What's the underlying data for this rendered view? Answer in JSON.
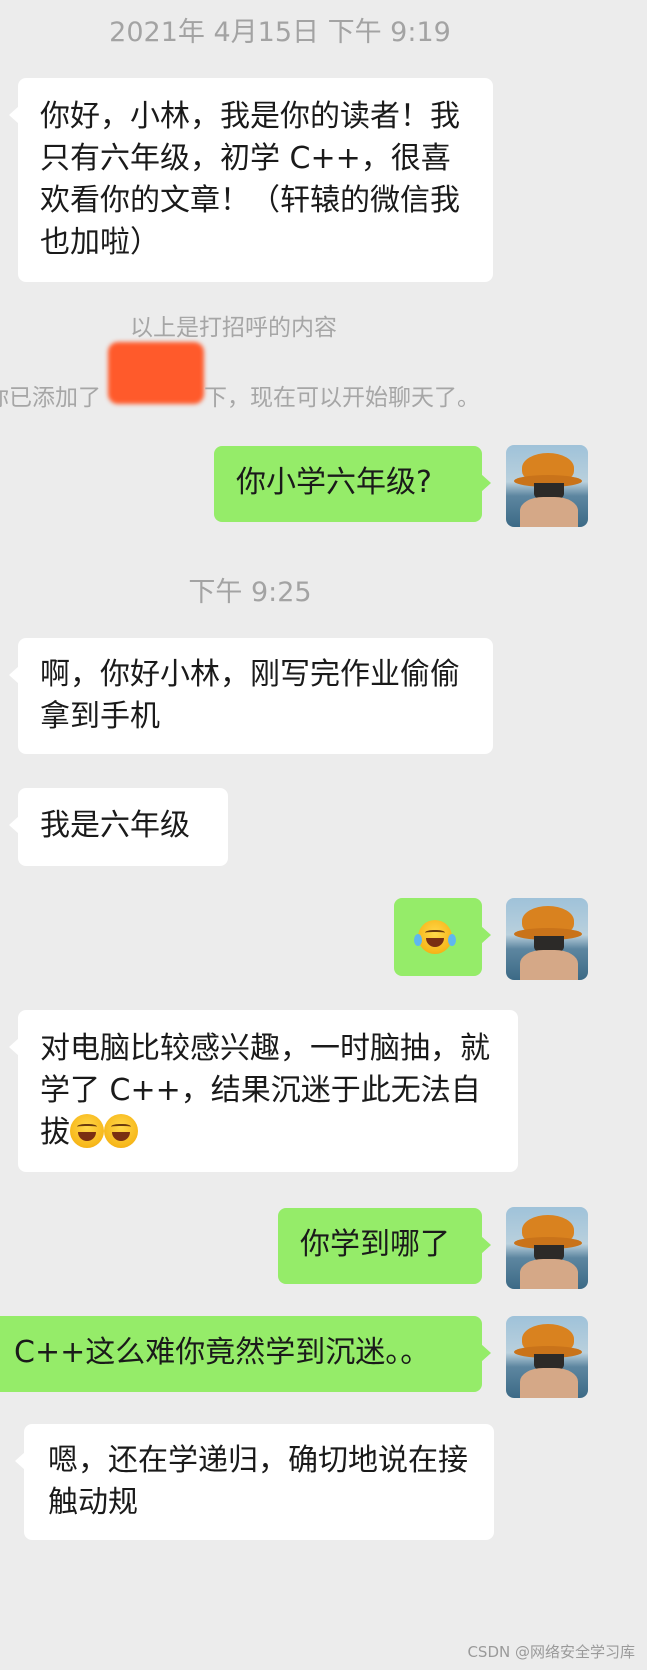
{
  "timestamps": {
    "first": "2021年 4月15日 下午 9:19",
    "second": "下午 9:25"
  },
  "system": {
    "greeting_note": "以上是打招呼的内容",
    "added_prefix": "你已添加了",
    "added_suffix": "下，现在可以开始聊天了。"
  },
  "messages": [
    {
      "from": "friend",
      "text": "你好，小林，我是你的读者！我只有六年级，初学 C++，很喜欢看你的文章！（轩辕的微信我也加啦）"
    },
    {
      "from": "me",
      "text": "你小学六年级?"
    },
    {
      "from": "friend",
      "text": "啊，你好小林，刚写完作业偷偷拿到手机"
    },
    {
      "from": "friend",
      "text": "我是六年级"
    },
    {
      "from": "me",
      "text": "",
      "emoji": "joy-emoji"
    },
    {
      "from": "friend",
      "text": "对电脑比较感兴趣，一时脑抽，就学了 C++，结果沉迷于此无法自拔",
      "emoji": "facepalm-emoji x2"
    },
    {
      "from": "me",
      "text": "你学到哪了"
    },
    {
      "from": "me",
      "text": "C++这么难你竟然学到沉迷。。"
    },
    {
      "from": "friend",
      "text": "嗯，还在学递归，确切地说在接触动规"
    }
  ],
  "watermark": "CSDN @网络安全学习库",
  "colors": {
    "background": "#ececec",
    "incoming": "#ffffff",
    "outgoing": "#95ec69",
    "redaction": "#ff5a2b"
  }
}
